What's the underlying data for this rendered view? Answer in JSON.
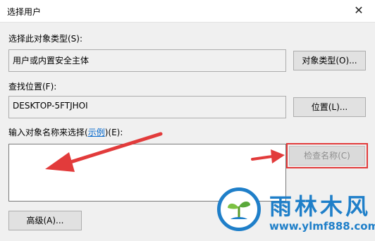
{
  "window": {
    "title": "选择用户",
    "close_glyph": "✕"
  },
  "object_type": {
    "label": "选择此对象类型(S):",
    "value": "用户或内置安全主体",
    "button": "对象类型(O)..."
  },
  "location": {
    "label": "查找位置(F):",
    "value": "DESKTOP-5FTJHOI",
    "button": "位置(L)..."
  },
  "object_names": {
    "label_prefix": "输入对象名称来选择(",
    "label_link": "示例",
    "label_suffix": ")(E):",
    "value": "",
    "check_button": "检查名称(C)"
  },
  "advanced_button": "高级(A)...",
  "watermark": {
    "title": "雨林木风",
    "url": "www.ylmf888.com"
  },
  "annotation_color": "#e23b3b",
  "watermark_color": "#1f7fc9"
}
